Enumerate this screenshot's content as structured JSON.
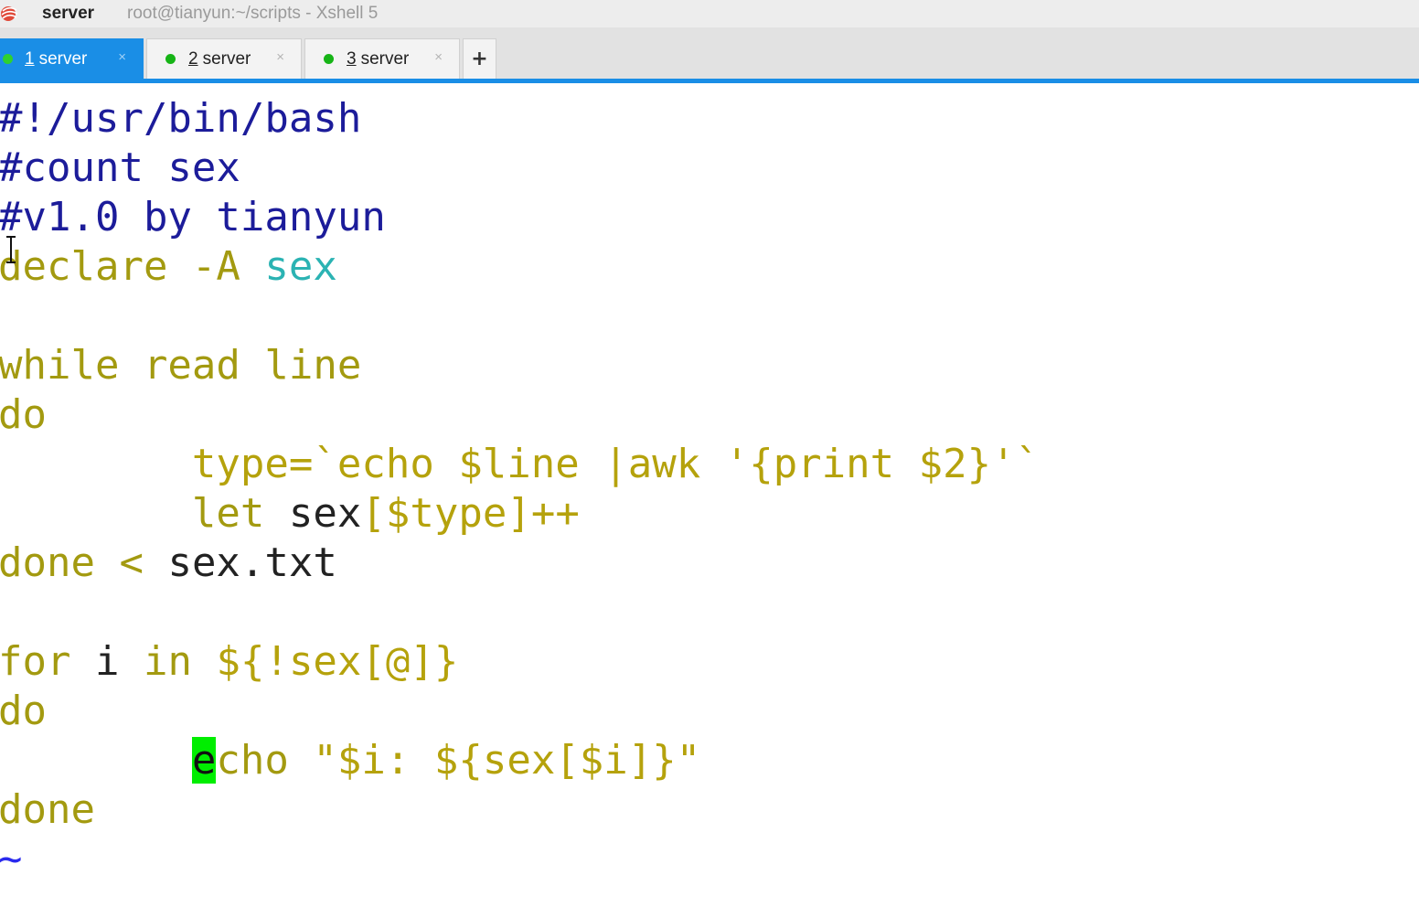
{
  "window": {
    "session_name": "server",
    "title": "root@tianyun:~/scripts - Xshell 5"
  },
  "tabs": [
    {
      "num": "1",
      "label": "server",
      "active": true
    },
    {
      "num": "2",
      "label": "server",
      "active": false
    },
    {
      "num": "3",
      "label": "server",
      "active": false
    }
  ],
  "tab_add_label": "+",
  "tab_close_glyph": "×",
  "colors": {
    "accent": "#1a8ee6",
    "status_dot": "#16b416",
    "cursor": "#00ee00"
  },
  "editor": {
    "lines": {
      "l1": "#!/usr/bin/bash",
      "l2": "#count sex",
      "l3": "#v1.0 by tianyun",
      "l4_kw": "declare -A",
      "l4_var": "sex",
      "l6": "while read line",
      "l7": "do",
      "l8_kw": "type=`echo $line |awk '{print $2}'`",
      "l9_kw": "let",
      "l9_plain": "sex",
      "l9_rest": "[$type]++",
      "l10_kw": "done <",
      "l10_plain": "sex.txt",
      "l12_kw1": "for",
      "l12_plain": "i",
      "l12_kw2": "in",
      "l12_rest": "${!sex[@]}",
      "l13": "do",
      "l14_cursor": "e",
      "l14_kw": "cho",
      "l14_str": "\"$i: ${sex[$i]}\"",
      "l15": "done",
      "l16": "~"
    }
  }
}
